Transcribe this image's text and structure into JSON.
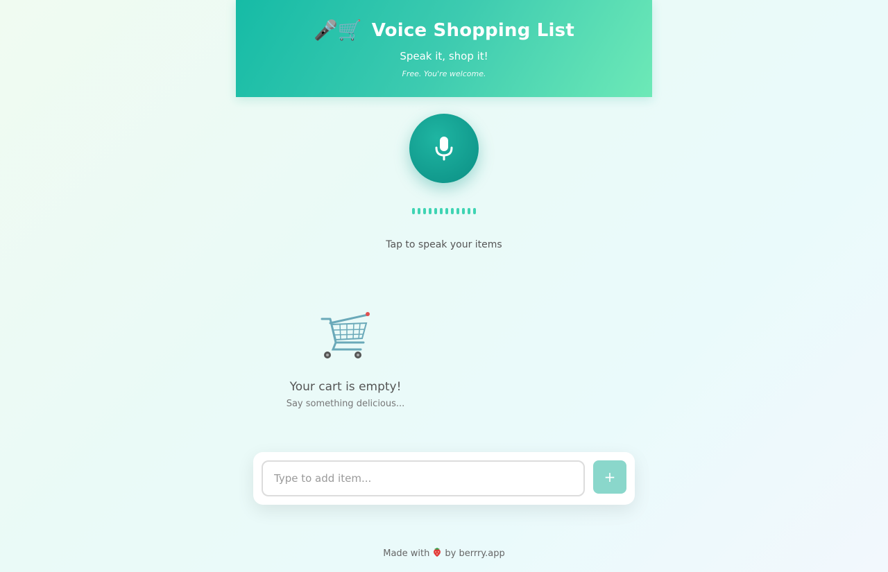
{
  "header": {
    "title_emoji": "🎤🛒",
    "title": "Voice Shopping List",
    "subtitle": "Speak it, shop it!",
    "tagline": "Free. You're welcome."
  },
  "mic": {
    "icon": "microphone-icon",
    "hint": "Tap to speak your items",
    "waveform_bars": 12
  },
  "cart": {
    "icon": "shopping-cart-icon",
    "empty_title": "Your cart is empty!",
    "empty_subtitle": "Say something delicious..."
  },
  "add_item": {
    "placeholder": "Type to add item...",
    "value": "",
    "button_label": "+"
  },
  "footer": {
    "made_with": "Made with",
    "by": "by berrry.app",
    "icon": "strawberry-icon"
  },
  "colors": {
    "accent": "#1ab9a5",
    "accent_dark": "#119a8d",
    "header_gradient_end": "#6de9b7",
    "wave": "#3fd4b3",
    "add_button": "#8ad7cb"
  }
}
